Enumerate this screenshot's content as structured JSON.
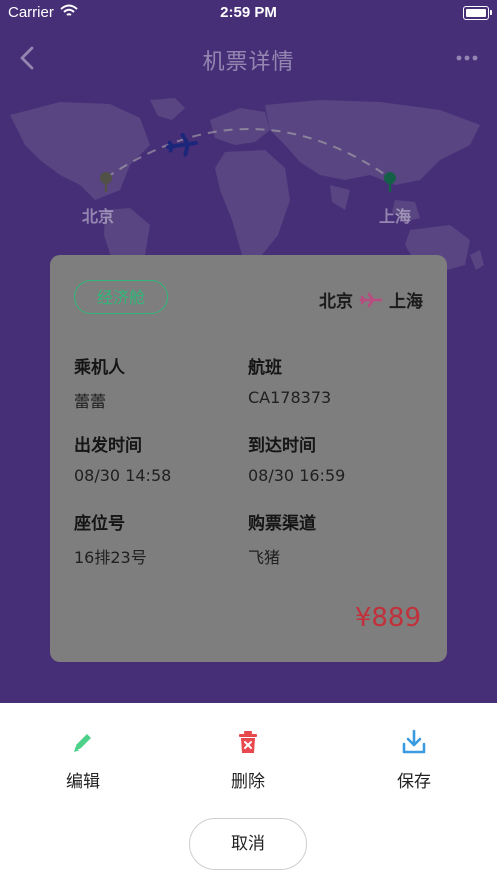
{
  "status_bar": {
    "carrier": "Carrier",
    "time": "2:59 PM"
  },
  "nav": {
    "title": "机票详情",
    "back_icon": "chevron-left-icon",
    "more_icon": "more-horizontal-icon"
  },
  "map": {
    "from_city": "北京",
    "to_city": "上海"
  },
  "ticket": {
    "cabin": "经济舱",
    "route_from": "北京",
    "route_to": "上海",
    "fields": [
      {
        "label": "乘机人",
        "value": "蕾蕾"
      },
      {
        "label": "航班",
        "value": "CA178373"
      },
      {
        "label": "出发时间",
        "value": "08/30 14:58"
      },
      {
        "label": "到达时间",
        "value": "08/30 16:59"
      },
      {
        "label": "座位号",
        "value": "16排23号"
      },
      {
        "label": "购票渠道",
        "value": "飞猪"
      }
    ],
    "price": "¥889"
  },
  "actions": {
    "edit_label": "编辑",
    "delete_label": "删除",
    "save_label": "保存",
    "cancel_label": "取消"
  },
  "colors": {
    "hero_purple": "#6b46b3",
    "cabin_green": "#2fb87a",
    "price_red": "#c1313b",
    "edit_green": "#4cd08a",
    "delete_red": "#e8484e",
    "save_blue": "#3a9be0"
  }
}
